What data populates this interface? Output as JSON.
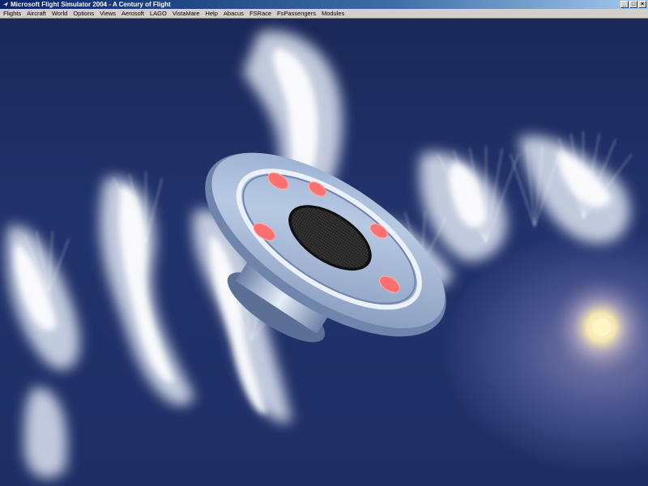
{
  "window": {
    "title": "Microsoft Flight Simulator 2004 - A Century of Flight",
    "controls": {
      "minimize": "_",
      "maximize": "□",
      "close": "×"
    }
  },
  "menu": {
    "items": [
      "Flights",
      "Aircraft",
      "World",
      "Options",
      "Views",
      "Aerosoft",
      "LAGO",
      "VistaMare",
      "Help",
      "Abacus",
      "FSRace",
      "FsPassengers",
      "Modules"
    ]
  },
  "scene": {
    "colors": {
      "sky": "#1a2758",
      "cloud": "#ffffff",
      "saucer": "#a9bcd8",
      "lights": "#ff6f6f",
      "sun": "#fff3c0"
    }
  }
}
